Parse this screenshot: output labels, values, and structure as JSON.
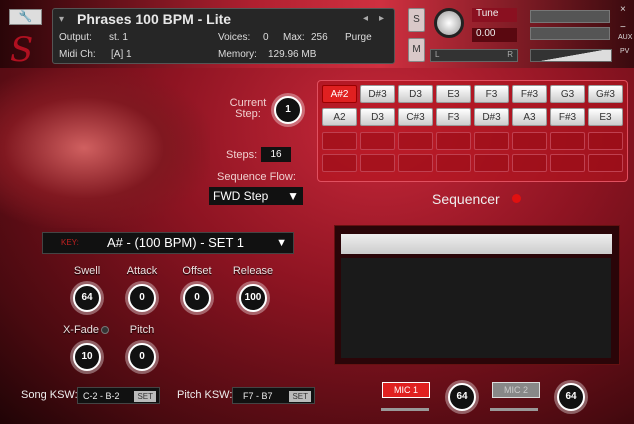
{
  "header": {
    "title": "Phrases 100 BPM - Lite",
    "output_label": "Output:",
    "output_value": "st. 1",
    "voices_label": "Voices:",
    "voices_value": "0",
    "max_label": "Max:",
    "max_value": "256",
    "purge": "Purge",
    "midi_label": "Midi Ch:",
    "midi_value": "[A]  1",
    "memory_label": "Memory:",
    "memory_value": "129.96 MB",
    "solo": "S",
    "mute": "M",
    "tune_label": "Tune",
    "tune_value": "0.00",
    "pan_l": "L",
    "pan_r": "R",
    "aux": "AUX",
    "pv": "PV",
    "close": "×",
    "minimize": "−"
  },
  "sequencer": {
    "current_step_label": "Current Step:",
    "current_step": "1",
    "steps_label": "Steps:",
    "steps": "16",
    "flow_label": "Sequence Flow:",
    "flow_value": "FWD Step",
    "title": "Sequencer",
    "row1": [
      "A#2",
      "D#3",
      "D3",
      "E3",
      "F3",
      "F#3",
      "G3",
      "G#3"
    ],
    "row2": [
      "A2",
      "D3",
      "C#3",
      "F3",
      "D#3",
      "A3",
      "F#3",
      "E3"
    ],
    "active_index": 0
  },
  "key": {
    "label": "KEY:",
    "value": "A# - (100 BPM) - SET 1"
  },
  "knobs": [
    {
      "label": "Swell",
      "value": "64"
    },
    {
      "label": "Attack",
      "value": "0"
    },
    {
      "label": "Offset",
      "value": "0"
    },
    {
      "label": "Release",
      "value": "100"
    },
    {
      "label": "X-Fade",
      "value": "10"
    },
    {
      "label": "Pitch",
      "value": "0"
    }
  ],
  "ksw": {
    "song_label": "Song KSW:",
    "song_value": "C-2 - B-2",
    "pitch_label": "Pitch KSW:",
    "pitch_value": "F7 - B7",
    "set": "SET"
  },
  "mics": [
    {
      "label": "MIC 1",
      "value": "64"
    },
    {
      "label": "MIC 2",
      "value": "64"
    }
  ]
}
